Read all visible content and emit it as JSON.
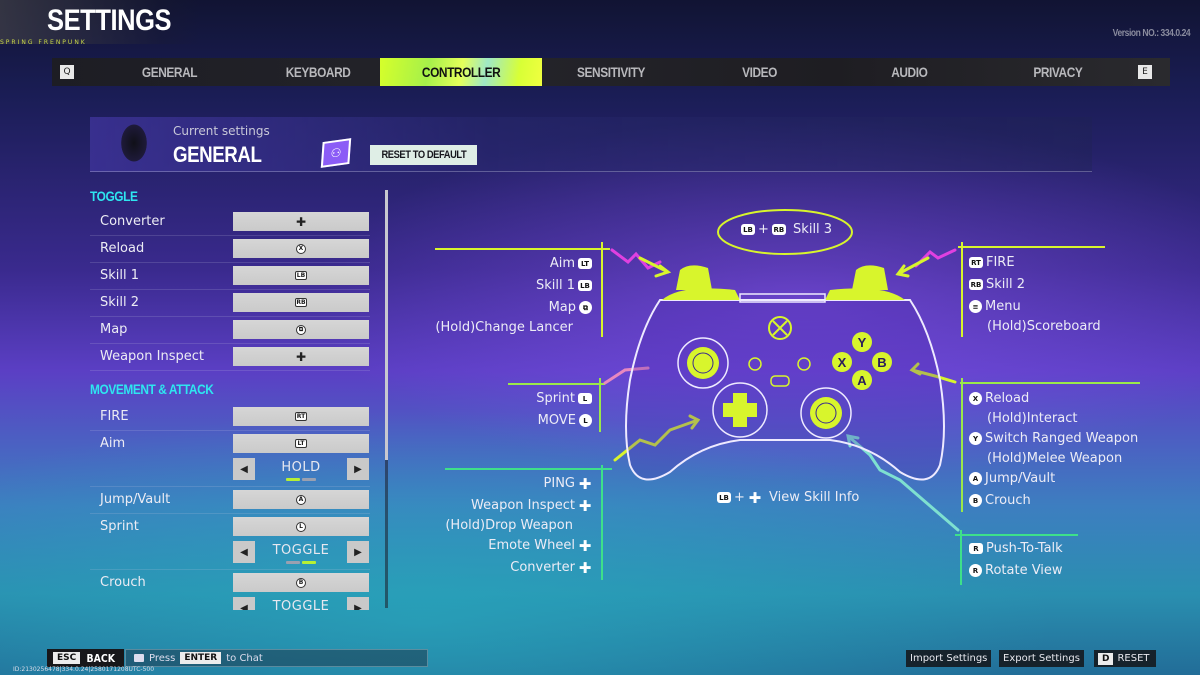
{
  "header": {
    "title": "SETTINGS",
    "subtitle_strip": "SPRING FRENPUNK",
    "version": "Version NO.: 334.0.24"
  },
  "tabs": {
    "prev_key": "Q",
    "next_key": "E",
    "items": [
      {
        "label": "GENERAL",
        "active": false
      },
      {
        "label": "KEYBOARD",
        "active": false
      },
      {
        "label": "CONTROLLER",
        "active": true
      },
      {
        "label": "SENSITIVITY",
        "active": false
      },
      {
        "label": "VIDEO",
        "active": false
      },
      {
        "label": "AUDIO",
        "active": false
      },
      {
        "label": "PRIVACY",
        "active": false
      }
    ]
  },
  "banner": {
    "current_label": "Current settings",
    "current_value": "GENERAL",
    "preset_icon": "preset-icon",
    "reset_label": "RESET TO DEFAULT"
  },
  "panel": {
    "sections": [
      {
        "title": "TOGGLE"
      },
      {
        "title": "MOVEMENT & ATTACK"
      }
    ],
    "toggle_rows": [
      {
        "label": "Converter",
        "glyph": "✚",
        "glyph_type": "dpad"
      },
      {
        "label": "Reload",
        "glyph": "X",
        "glyph_type": "circle"
      },
      {
        "label": "Skill 1",
        "glyph": "LB",
        "glyph_type": "tag"
      },
      {
        "label": "Skill 2",
        "glyph": "RB",
        "glyph_type": "tag"
      },
      {
        "label": "Map",
        "glyph": "⧉",
        "glyph_type": "circle"
      },
      {
        "label": "Weapon Inspect",
        "glyph": "✚",
        "glyph_type": "dpad"
      }
    ],
    "movement_rows": [
      {
        "label": "FIRE",
        "glyph": "RT",
        "glyph_type": "tag"
      },
      {
        "label": "Aim",
        "glyph": "LT",
        "glyph_type": "tag",
        "mode": "HOLD",
        "mode_index": 0,
        "mode_count": 2
      },
      {
        "label": "Jump/Vault",
        "glyph": "A",
        "glyph_type": "circle"
      },
      {
        "label": "Sprint",
        "glyph": "L",
        "glyph_type": "circle",
        "mode": "TOGGLE",
        "mode_index": 1,
        "mode_count": 2
      },
      {
        "label": "Crouch",
        "glyph": "B",
        "glyph_type": "circle",
        "mode": "TOGGLE"
      }
    ],
    "scroll_position": 0.0
  },
  "diagram": {
    "skill3": {
      "glyph_a": "LB",
      "glyph_b": "RB",
      "label": "Skill 3"
    },
    "left_top": [
      {
        "label": "Aim",
        "glyph": "LT"
      },
      {
        "label": "Skill 1",
        "glyph": "LB"
      },
      {
        "label": "Map",
        "glyph": "⧉"
      },
      {
        "label": "(Hold)Change Lancer",
        "glyph": ""
      }
    ],
    "left_mid": [
      {
        "label": "Sprint",
        "glyph": "L"
      },
      {
        "label": "MOVE",
        "glyph": "L"
      }
    ],
    "left_bottom": [
      {
        "label": "PING",
        "glyph": "✚"
      },
      {
        "label": "Weapon Inspect",
        "glyph": "✚"
      },
      {
        "label": "(Hold)Drop Weapon",
        "glyph": ""
      },
      {
        "label": "Emote Wheel",
        "glyph": "✚"
      },
      {
        "label": "Converter",
        "glyph": "✚"
      }
    ],
    "right_top": [
      {
        "label": "FIRE",
        "glyph": "RT"
      },
      {
        "label": "Skill 2",
        "glyph": "RB"
      },
      {
        "label": "Menu",
        "glyph": "≡"
      },
      {
        "label": "(Hold)Scoreboard",
        "glyph": ""
      }
    ],
    "right_mid": [
      {
        "label": "Reload",
        "glyph": "X"
      },
      {
        "label": "(Hold)Interact",
        "glyph": ""
      },
      {
        "label": "Switch Ranged Weapon",
        "glyph": "Y"
      },
      {
        "label": "(Hold)Melee Weapon",
        "glyph": ""
      },
      {
        "label": "Jump/Vault",
        "glyph": "A"
      },
      {
        "label": "Crouch",
        "glyph": "B"
      }
    ],
    "right_bottom": [
      {
        "label": "Push-To-Talk",
        "glyph": "R"
      },
      {
        "label": "Rotate View",
        "glyph": "R"
      }
    ],
    "view_skill_info": {
      "glyph_a": "LB",
      "glyph_b": "✚",
      "label": "View Skill Info"
    },
    "face_buttons": {
      "y": "Y",
      "x": "X",
      "b": "B",
      "a": "A"
    },
    "accent_color": "#d8f52c"
  },
  "footer": {
    "back_key": "ESC",
    "back_label": "BACK",
    "chat_prefix": "Press",
    "chat_key": "ENTER",
    "chat_suffix": "to Chat",
    "id_line": "ID:2130256478|334.0.24|2580171208UTC-500",
    "import_label": "Import Settings",
    "export_label": "Export Settings",
    "reset_key": "D",
    "reset_label": "RESET"
  }
}
